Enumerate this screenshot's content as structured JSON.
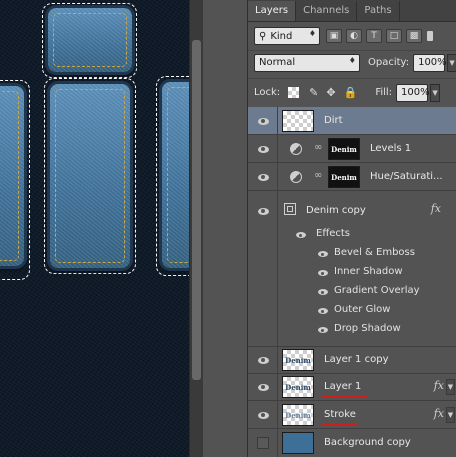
{
  "tabs": [
    {
      "label": "Layers",
      "active": true
    },
    {
      "label": "Channels",
      "active": false
    },
    {
      "label": "Paths",
      "active": false
    }
  ],
  "filter": {
    "kind_label": "Kind"
  },
  "blend": {
    "mode": "Normal",
    "opacity_label": "Opacity:",
    "opacity_value": "100%"
  },
  "lock": {
    "label": "Lock:",
    "fill_label": "Fill:",
    "fill_value": "100%"
  },
  "layers": [
    {
      "name": "Dirt",
      "selected": true
    },
    {
      "name": "Levels 1",
      "thumb_text": "Denim"
    },
    {
      "name": "Hue/Saturati...",
      "thumb_text": "Denim"
    },
    {
      "name": "Denim copy",
      "has_fx": true
    },
    {
      "name": "Layer 1 copy",
      "thumb_text": "Denim"
    },
    {
      "name": "Layer 1",
      "thumb_text": "Denim",
      "has_fx": true,
      "underlined": true
    },
    {
      "name": "Stroke",
      "thumb_text": "Denim",
      "has_fx": true,
      "underlined": true
    },
    {
      "name": "Background copy"
    }
  ],
  "effects": {
    "header": "Effects",
    "items": [
      "Bevel & Emboss",
      "Inner Shadow",
      "Gradient Overlay",
      "Outer Glow",
      "Drop Shadow"
    ]
  },
  "fx_label": "fx",
  "colors": {
    "panel_bg": "#535353",
    "selected_row": "#6d7b91",
    "denim": "#4a7ba4",
    "stitch": "#c9a64a",
    "annotation_red": "#d31d1d"
  }
}
